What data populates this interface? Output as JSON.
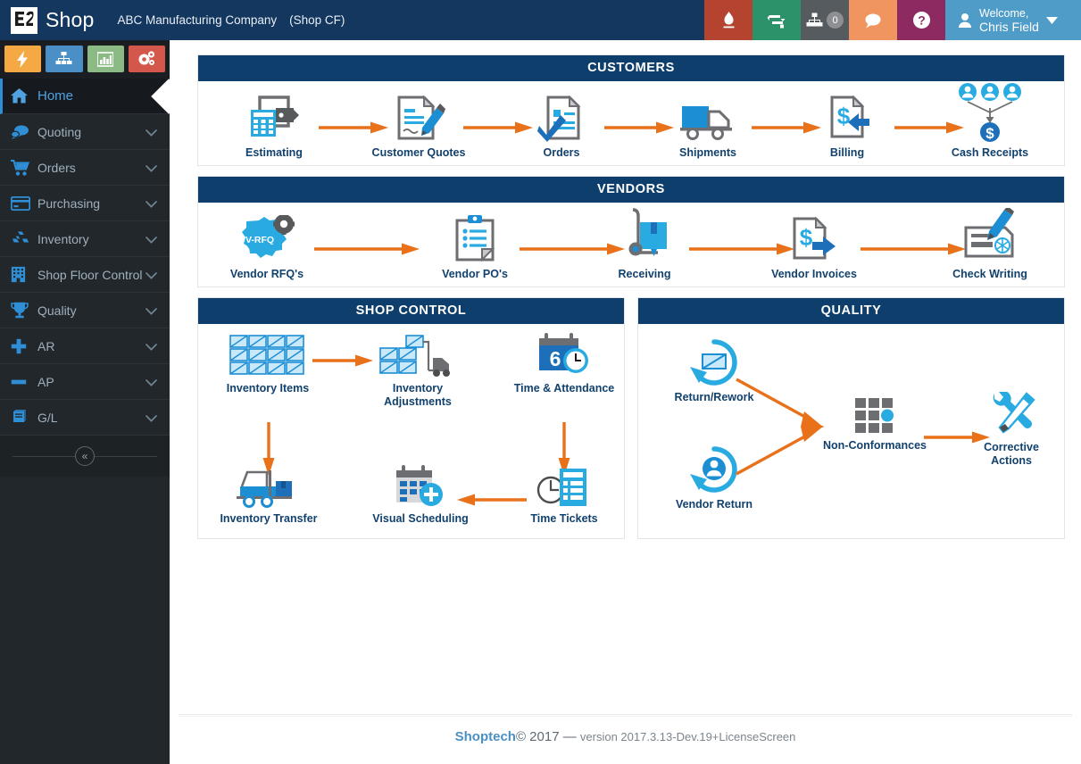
{
  "topbar": {
    "brand_name": "Shop",
    "logo_text": "E2",
    "company": "ABC Manufacturing Company",
    "shop_code": "(Shop CF)",
    "actions": [
      {
        "name": "alerts-icon",
        "label": "",
        "color": "#b44430"
      },
      {
        "name": "sync-icon",
        "label": "",
        "color": "#2c9269"
      },
      {
        "name": "org-chart-icon",
        "label": "",
        "color": "#555b5f",
        "badge": "0"
      },
      {
        "name": "chat-icon",
        "label": "",
        "color": "#f0955f"
      },
      {
        "name": "help-icon",
        "label": "",
        "color": "#8c2a61"
      }
    ],
    "user": {
      "greeting": "Welcome,",
      "name": "Chris Field",
      "bg": "#4f9cc9"
    }
  },
  "sidebar": {
    "quick_tiles": [
      {
        "name": "bolt-tile",
        "color": "#f5a945"
      },
      {
        "name": "sitemap-tile",
        "color": "#4a8fc5"
      },
      {
        "name": "chart-tile",
        "color": "#8bba84"
      },
      {
        "name": "settings-tile",
        "color": "#d3574a"
      }
    ],
    "items": [
      {
        "label": "Home",
        "icon": "home-icon",
        "active": true,
        "chevron": false
      },
      {
        "label": "Quoting",
        "icon": "quoting-icon",
        "active": false,
        "chevron": true
      },
      {
        "label": "Orders",
        "icon": "orders-icon",
        "active": false,
        "chevron": true
      },
      {
        "label": "Purchasing",
        "icon": "purchasing-icon",
        "active": false,
        "chevron": true
      },
      {
        "label": "Inventory",
        "icon": "inventory-icon",
        "active": false,
        "chevron": true
      },
      {
        "label": "Shop Floor Control",
        "icon": "shop-floor-icon",
        "active": false,
        "chevron": true
      },
      {
        "label": "Quality",
        "icon": "quality-icon",
        "active": false,
        "chevron": true
      },
      {
        "label": "AR",
        "icon": "plus-icon",
        "active": false,
        "chevron": true
      },
      {
        "label": "AP",
        "icon": "minus-icon",
        "active": false,
        "chevron": true
      },
      {
        "label": "G/L",
        "icon": "ledger-icon",
        "active": false,
        "chevron": true
      }
    ],
    "collapse_label": "«"
  },
  "workflow": {
    "sections": [
      {
        "title": "CUSTOMERS",
        "nodes": [
          {
            "label": "Estimating",
            "icon": "estimating-icon"
          },
          {
            "label": "Customer Quotes",
            "icon": "customer-quotes-icon"
          },
          {
            "label": "Orders",
            "icon": "orders-doc-icon"
          },
          {
            "label": "Shipments",
            "icon": "shipments-truck-icon"
          },
          {
            "label": "Billing",
            "icon": "billing-invoice-icon"
          },
          {
            "label": "Cash Receipts",
            "icon": "cash-receipts-icon"
          }
        ]
      },
      {
        "title": "VENDORS",
        "nodes": [
          {
            "label": "Vendor RFQ's",
            "icon": "vendor-rfq-icon"
          },
          {
            "label": "Vendor PO's",
            "icon": "vendor-po-icon"
          },
          {
            "label": "Receiving",
            "icon": "receiving-icon"
          },
          {
            "label": "Vendor Invoices",
            "icon": "vendor-invoices-icon"
          },
          {
            "label": "Check Writing",
            "icon": "check-writing-icon"
          }
        ]
      },
      {
        "title": "SHOP CONTROL",
        "nodes": [
          {
            "label": "Inventory Items",
            "icon": "inventory-items-icon"
          },
          {
            "label": "Inventory Adjustments",
            "icon": "inventory-adjustments-icon"
          },
          {
            "label": "Time & Attendance",
            "icon": "time-attendance-icon"
          },
          {
            "label": "Inventory Transfer",
            "icon": "inventory-transfer-icon"
          },
          {
            "label": "Visual Scheduling",
            "icon": "visual-scheduling-icon"
          },
          {
            "label": "Time Tickets",
            "icon": "time-tickets-icon"
          }
        ]
      },
      {
        "title": "QUALITY",
        "nodes": [
          {
            "label": "Return/Rework",
            "icon": "return-rework-icon"
          },
          {
            "label": "Vendor Return",
            "icon": "vendor-return-icon"
          },
          {
            "label": "Non-Conformances",
            "icon": "non-conformances-icon"
          },
          {
            "label": "Corrective Actions",
            "icon": "corrective-actions-icon"
          }
        ]
      }
    ]
  },
  "footer": {
    "brand": "Shoptech",
    "copyright": "© 2017 — ",
    "version": "version 2017.3.13-Dev.19+LicenseScreen"
  },
  "colors": {
    "header_bg": "#14375f",
    "panel_head": "#0e3e6b",
    "arrow": "#e8711a",
    "caption": "#11416d",
    "accent_blue": "#2e8fd6",
    "light_blue": "#29abe2",
    "gray_icon": "#6d6e71"
  }
}
